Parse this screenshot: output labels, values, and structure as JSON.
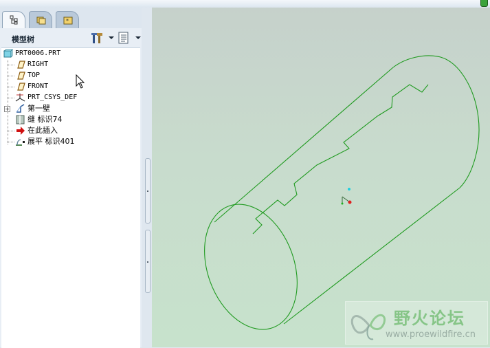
{
  "navigator": {
    "tabs": [
      {
        "icon": "model-tree-icon",
        "active": true
      },
      {
        "icon": "folder-browser-icon",
        "active": false
      },
      {
        "icon": "favorites-icon",
        "active": false
      }
    ],
    "tree_title": "模型树",
    "header_buttons": [
      "settings-tools-icon",
      "show-options-icon"
    ]
  },
  "model_tree": {
    "items": [
      {
        "label": "PRT0006.PRT",
        "icon": "part-icon"
      },
      {
        "label": "RIGHT",
        "icon": "datum-plane-icon"
      },
      {
        "label": "TOP",
        "icon": "datum-plane-icon"
      },
      {
        "label": "FRONT",
        "icon": "datum-plane-icon"
      },
      {
        "label": "PRT_CSYS_DEF",
        "icon": "coordinate-system-icon"
      },
      {
        "label": "第一壁",
        "icon": "sheetmetal-wall-icon"
      },
      {
        "label": "缝 标识74",
        "icon": "rip-icon"
      },
      {
        "label": "在此插入",
        "icon": "insert-here-arrow-icon"
      },
      {
        "label": "展平 标识401",
        "icon": "unbend-icon"
      }
    ]
  },
  "watermark": {
    "title": "野火论坛",
    "url": "www.proewildfire.cn"
  },
  "colors": {
    "model_edge": "#1f9a1f",
    "insert_arrow": "#d01010",
    "status_indicator": "#3aa23a"
  }
}
